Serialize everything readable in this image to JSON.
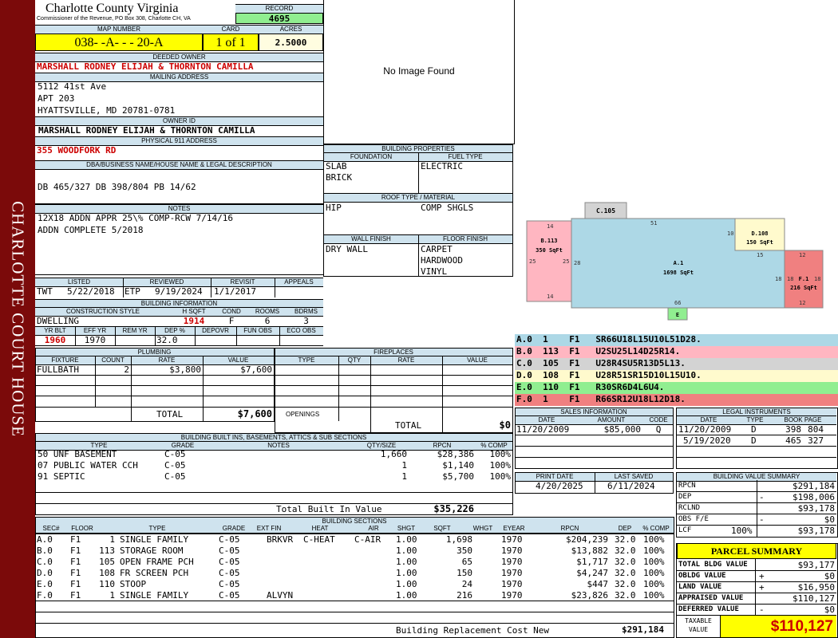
{
  "side_title": "CHARLOTTE COURT HOUSE",
  "county": {
    "name": "Charlotte County Virginia",
    "sub": "Commissioner of the Revenue, PO Box 308, Charlotte CH, VA"
  },
  "record": {
    "label": "RECORD",
    "value": "4695"
  },
  "map": {
    "label": "MAP NUMBER",
    "value": "038- -A- - - 20-A"
  },
  "card": {
    "label": "CARD",
    "value": "1 of 1"
  },
  "acres": {
    "label": "ACRES",
    "value": "2.5000"
  },
  "deeded_owner": {
    "label": "DEEDED OWNER",
    "value": "MARSHALL RODNEY ELIJAH & THORNTON CAMILLA"
  },
  "mailing": {
    "label": "MAILING ADDRESS",
    "line1": "5112 41st Ave",
    "line2": "APT 203",
    "line3": "HYATTSVILLE, MD 20781-0781"
  },
  "owner_id": {
    "label": "OWNER ID",
    "value": "MARSHALL RODNEY ELIJAH & THORNTON CAMILLA"
  },
  "physical": {
    "label": "PHYSICAL 911 ADDRESS",
    "value": "355 WOODFORK RD"
  },
  "legal": {
    "label": "DBA/BUSINESS NAME/HOUSE NAME & LEGAL DESCRIPTION",
    "value": "DB 465/327 DB 398/804 PB 14/62"
  },
  "notes": {
    "label": "NOTES",
    "line1": "12X18 ADDN APPR 25\\% COMP-RCW 7/14/16",
    "line2": "ADDN COMPLETE 5/2018"
  },
  "image": {
    "text": "No Image Found"
  },
  "listing": {
    "headers": [
      "LISTED",
      "REVIEWED",
      "REVISIT",
      "APPEALS"
    ],
    "listed_by": "TWT",
    "listed_date": "5/22/2018",
    "reviewed_by": "ETP",
    "reviewed_date": "9/19/2024",
    "revisit": "1/1/2017",
    "appeals": ""
  },
  "building_info": {
    "label": "BUILDING INFORMATION",
    "h1": [
      "CONSTRUCTION STYLE",
      "H SQFT",
      "COND",
      "ROOMS",
      "BDRMS"
    ],
    "v1": [
      "DWELLING",
      "1914",
      "F",
      "6",
      "3"
    ],
    "h2": [
      "YR BLT",
      "EFF YR",
      "REM YR",
      "DEP %",
      "DEPOVR",
      "FUN OBS",
      "ECO OBS"
    ],
    "v2": [
      "1960",
      "1970",
      "",
      "32.0",
      "",
      "",
      ""
    ]
  },
  "building_props": {
    "label": "BUILDING PROPERTIES",
    "foundation_label": "FOUNDATION",
    "foundation": [
      "SLAB",
      "BRICK"
    ],
    "fuel_label": "FUEL TYPE",
    "fuel": [
      "ELECTRIC"
    ],
    "roof_label": "ROOF TYPE / MATERIAL",
    "roof_type": "HIP",
    "roof_material": "COMP SHGLS",
    "wall_label": "WALL FINISH",
    "wall": [
      "DRY WALL"
    ],
    "floor_label": "FLOOR FINISH",
    "floor": [
      "CARPET",
      "HARDWOOD",
      "VINYL"
    ]
  },
  "sketch": {
    "c105": "C.105",
    "b113": "B.113",
    "b113_area": "350 SqFt",
    "a1": "A.1",
    "a1_area": "1698 SqFt",
    "d108": "D.108",
    "d108_area": "150 SqFt",
    "f1": "F.1",
    "f1_area": "216 SqFt",
    "e": "E",
    "dims": {
      "d14a": "14",
      "d14b": "14",
      "d25a": "25",
      "d25b": "25",
      "d28": "28",
      "d51": "51",
      "d10": "10",
      "d15": "15",
      "d12a": "12",
      "d12b": "12",
      "d18a": "18",
      "d18b": "18",
      "d18c": "18",
      "d66": "66"
    }
  },
  "vectors": [
    {
      "text": "A.0  1    F1   SR66U18L15U10L51D28.",
      "color": "#add8e6"
    },
    {
      "text": "B.0  113  F1   U2SU25L14D25R14.",
      "color": "#ffb6c1"
    },
    {
      "text": "C.0  105  F1   U28R4SU5R13D5L13.",
      "color": "#d3d3d3"
    },
    {
      "text": "D.0  108  F1   U28R51SR15D10L15U10.",
      "color": "#fffacd"
    },
    {
      "text": "E.0  110  F1   R30SR6D4L6U4.",
      "color": "#90ee90"
    },
    {
      "text": "F.0  1    F1   R66SR12U18L12D18.",
      "color": "#f08080"
    }
  ],
  "plumbing": {
    "label": "PLUMBING",
    "headers": [
      "FIXTURE",
      "COUNT",
      "RATE",
      "VALUE"
    ],
    "rows": [
      {
        "fixture": "FULLBATH",
        "count": "2",
        "rate": "$3,800",
        "value": "$7,600"
      }
    ],
    "total_label": "TOTAL",
    "total": "$7,600"
  },
  "fireplaces": {
    "label": "FIREPLACES",
    "headers": [
      "TYPE",
      "QTY",
      "RATE",
      "VALUE"
    ],
    "openings_label": "OPENINGS",
    "total_label": "TOTAL",
    "total": "$0"
  },
  "builtins": {
    "label": "BUILDING BUILT INS, BASEMENTS, ATTICS & SUB SECTIONS",
    "headers": [
      "TYPE",
      "GRADE",
      "NOTES",
      "QTY/SIZE",
      "RPCN",
      "% COMP"
    ],
    "rows": [
      {
        "type": "50 UNF BASEMENT",
        "grade": "C-05",
        "qty": "1,660",
        "rpcn": "$28,386",
        "comp": "100%"
      },
      {
        "type": "07 PUBLIC WATER CCH",
        "grade": "C-05",
        "qty": "1",
        "rpcn": "$1,140",
        "comp": "100%"
      },
      {
        "type": "91 SEPTIC",
        "grade": "C-05",
        "qty": "1",
        "rpcn": "$5,700",
        "comp": "100%"
      }
    ],
    "total_label": "Total Built In Value",
    "total": "$35,226"
  },
  "sales": {
    "label": "SALES INFORMATION",
    "headers": [
      "DATE",
      "AMOUNT",
      "CODE"
    ],
    "rows": [
      {
        "date": "11/20/2009",
        "amount": "$85,000",
        "code": "Q"
      }
    ]
  },
  "instruments": {
    "label": "LEGAL INSTRUMENTS",
    "headers": [
      "DATE",
      "TYPE",
      "BOOK PAGE"
    ],
    "rows": [
      {
        "date": "11/20/2009",
        "type": "D",
        "book": "398",
        "page": "804"
      },
      {
        "date": "5/19/2020",
        "type": "D",
        "book": "465",
        "page": "327"
      }
    ]
  },
  "print": {
    "print_label": "PRINT DATE",
    "print_date": "4/20/2025",
    "saved_label": "LAST SAVED",
    "saved_date": "6/11/2024"
  },
  "value_summary": {
    "label": "BUILDING VALUE SUMMARY",
    "rpcn_label": "RPCN",
    "rpcn": "$291,184",
    "dep_label": "DEP",
    "dep_sign": "-",
    "dep": "$198,006",
    "rclnd_label": "RCLND",
    "rclnd": "$93,178",
    "obs_label": "OBS F/E",
    "obs_sign": "-",
    "obs": "$0",
    "lcf_label": "LCF",
    "lcf_pct": "100%",
    "lcf": "$93,178"
  },
  "parcel": {
    "label": "PARCEL SUMMARY",
    "bldg_label": "TOTAL BLDG VALUE",
    "bldg": "$93,177",
    "obldg_label": "OBLDG VALUE",
    "obldg_sign": "+",
    "obldg": "$0",
    "land_label": "LAND VALUE",
    "land_sign": "+",
    "land": "$16,950",
    "appraised_label": "APPRAISED VALUE",
    "appraised": "$110,127",
    "deferred_label": "DEFERRED VALUE",
    "deferred_sign": "-",
    "deferred": "$0",
    "taxable_label1": "TAXABLE",
    "taxable_label2": "VALUE",
    "taxable": "$110,127"
  },
  "sections": {
    "label": "BUILDING SECTIONS",
    "headers": [
      "SEC#",
      "FLOOR",
      "TYPE",
      "GRADE",
      "EXT FIN",
      "HEAT",
      "AIR",
      "SHGT",
      "SQFT",
      "WHGT",
      "EYEAR",
      "RPCN",
      "DEP",
      "% COMP"
    ],
    "rows": [
      {
        "sec": "A.0",
        "floor": "F1",
        "code": "1",
        "type": "SINGLE FAMILY",
        "grade": "C-05",
        "ext": "BRKVR",
        "heat": "C-HEAT",
        "air": "C-AIR",
        "shgt": "1.00",
        "sqft": "1,698",
        "eyear": "1970",
        "rpcn": "$204,239",
        "dep": "32.0",
        "comp": "100%"
      },
      {
        "sec": "B.0",
        "floor": "F1",
        "code": "113",
        "type": "STORAGE ROOM",
        "grade": "C-05",
        "ext": "",
        "heat": "",
        "air": "",
        "shgt": "1.00",
        "sqft": "350",
        "eyear": "1970",
        "rpcn": "$13,882",
        "dep": "32.0",
        "comp": "100%"
      },
      {
        "sec": "C.0",
        "floor": "F1",
        "code": "105",
        "type": "OPEN FRAME PCH",
        "grade": "C-05",
        "ext": "",
        "heat": "",
        "air": "",
        "shgt": "1.00",
        "sqft": "65",
        "eyear": "1970",
        "rpcn": "$1,717",
        "dep": "32.0",
        "comp": "100%"
      },
      {
        "sec": "D.0",
        "floor": "F1",
        "code": "108",
        "type": "FR SCREEN PCH",
        "grade": "C-05",
        "ext": "",
        "heat": "",
        "air": "",
        "shgt": "1.00",
        "sqft": "150",
        "eyear": "1970",
        "rpcn": "$4,247",
        "dep": "32.0",
        "comp": "100%"
      },
      {
        "sec": "E.0",
        "floor": "F1",
        "code": "110",
        "type": "STOOP",
        "grade": "C-05",
        "ext": "",
        "heat": "",
        "air": "",
        "shgt": "1.00",
        "sqft": "24",
        "eyear": "1970",
        "rpcn": "$447",
        "dep": "32.0",
        "comp": "100%"
      },
      {
        "sec": "F.0",
        "floor": "F1",
        "code": "1",
        "type": "SINGLE FAMILY",
        "grade": "C-05",
        "ext": "ALVYN",
        "heat": "",
        "air": "",
        "shgt": "1.00",
        "sqft": "216",
        "eyear": "1970",
        "rpcn": "$23,826",
        "dep": "32.0",
        "comp": "100%"
      }
    ],
    "total_label": "Building Replacement Cost New",
    "total": "$291,184"
  },
  "colors": {
    "sidebar": "#7b0a0a",
    "header": "#cfe3ee",
    "yellow": "#ffff00",
    "green": "#90ee90",
    "red": "#cc0000",
    "cream": "#fffde0"
  }
}
